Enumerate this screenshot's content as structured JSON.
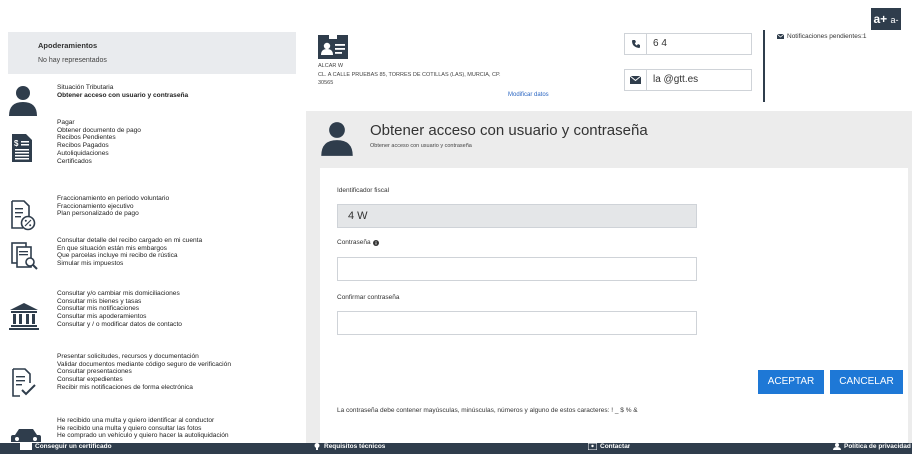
{
  "font_size": {
    "increase_label": "a+",
    "decrease_label": "a-"
  },
  "apoderamientos": {
    "title": "Apoderamientos",
    "subtitle": "No hay representados"
  },
  "sidebar": {
    "categories": [
      {
        "icon": "user-icon",
        "links": [
          "Situación Tributaria",
          "Obtener acceso con usuario y contraseña"
        ]
      },
      {
        "icon": "receipt-icon",
        "links": [
          "Pagar",
          "Obtener documento de pago",
          "Recibos Pendientes",
          "Recibos Pagados",
          "Autoliquidaciones",
          "Certificados"
        ]
      },
      {
        "icon": "percent-document-icon",
        "links": [
          "Fraccionamiento en periodo voluntario",
          "Fraccionamiento ejecutivo",
          "Plan personalizado de pago"
        ]
      },
      {
        "icon": "document-search-icon",
        "links": [
          "Consultar detalle del recibo cargado en mi cuenta",
          "En que situación están mis embargos",
          "Que parcelas incluye mi recibo de rústica",
          "Simular mis impuestos"
        ]
      },
      {
        "icon": "bank-icon",
        "links": [
          "Consultar y/o cambiar mis domiciliaciones",
          "Consultar mis bienes y tasas",
          "Consultar mis notificaciones",
          "Consultar mis apoderamientos",
          "Consultar y / o modificar datos de contacto"
        ]
      },
      {
        "icon": "document-check-icon",
        "links": [
          "Presentar solicitudes, recursos y documentación",
          "Validar documentos mediante código seguro de verificación",
          "Consultar presentaciones",
          "Consultar expedientes",
          "Recibir mis notificaciones de forma electrónica"
        ]
      },
      {
        "icon": "car-icon",
        "links": [
          "He recibido una multa y quiero identificar al conductor",
          "He recibido una multa y quiero consultar las fotos",
          "He comprado un vehículo y quiero hacer la autoliquidación"
        ]
      }
    ]
  },
  "profile": {
    "name": "ALCAR                              W",
    "address": "CL. A CALLE PRUEBAS 85, TORRES DE COTILLAS (LAS), MURCIA, CP.",
    "zip": "30565",
    "modify_label": "Modificar datos",
    "phone": "6               4",
    "email": "la          @gtt.es"
  },
  "notifications": {
    "label": "Notificaciones pendientes:1"
  },
  "panel": {
    "title": "Obtener acceso con usuario y contraseña",
    "subtitle": "Obtener acceso con usuario y contraseña"
  },
  "form": {
    "tax_id_label": "Identificador fiscal",
    "tax_id_value": "4             W",
    "password_label": "Contraseña",
    "confirm_label": "Confirmar contraseña",
    "accept_label": "ACEPTAR",
    "cancel_label": "CANCELAR",
    "help_text": "La contraseña debe contener mayúsculas, minúsculas, números y alguno de estos caracteres: ! _ $ % &"
  },
  "footer": {
    "certificate": "Conseguir un certificado",
    "requirements": "Requisitos técnicos",
    "contact": "Contactar",
    "privacy": "Política de privacidad"
  },
  "colors": {
    "accent": "#1e78d6",
    "dark": "#2f3d4c",
    "link": "#2a66c2"
  }
}
